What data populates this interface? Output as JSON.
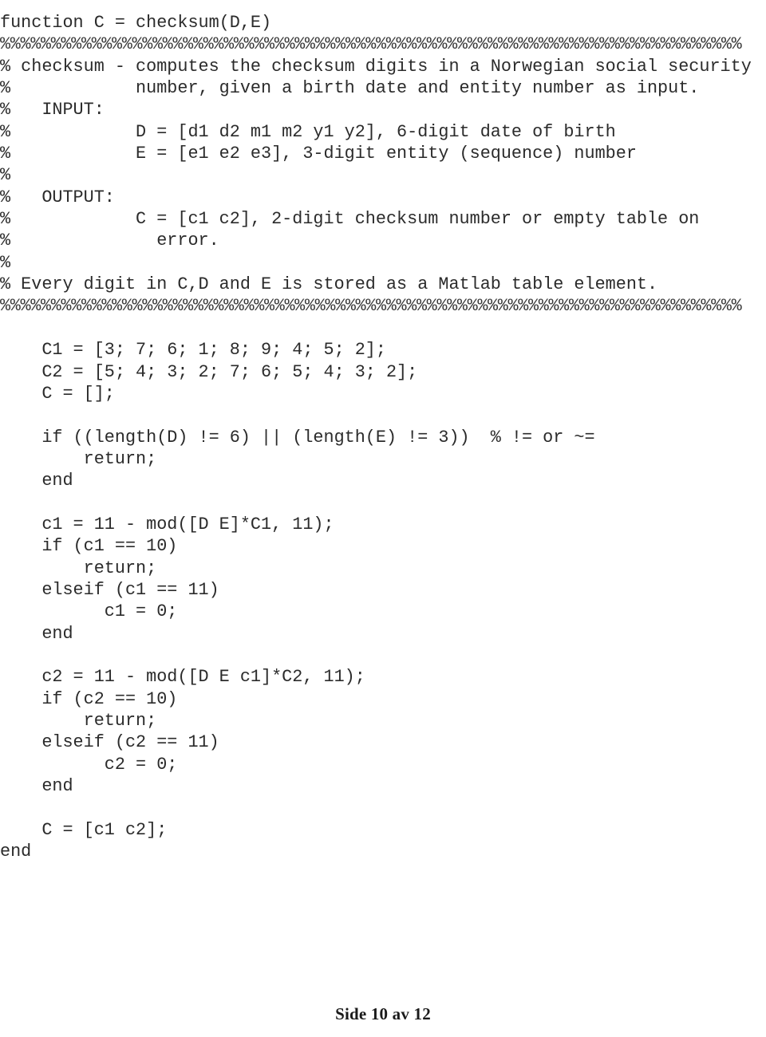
{
  "document": {
    "kind": "matlab-source-listing",
    "background_color": "#ffffff",
    "text_color": "#2b2b2b",
    "footer_color": "#1a1a1a"
  },
  "code": {
    "language": "MATLAB",
    "lines": [
      "function C = checksum(D,E)",
      "%%%%%%%%%%%%%%%%%%%%%%%%%%%%%%%%%%%%%%%%%%%%%%%%%%%%%%%%%%%%%%%%%%%%%%%%%",
      "% checksum - computes the checksum digits in a Norwegian social security",
      "%            number, given a birth date and entity number as input.",
      "%   INPUT:",
      "%            D = [d1 d2 m1 m2 y1 y2], 6-digit date of birth",
      "%            E = [e1 e2 e3], 3-digit entity (sequence) number",
      "%",
      "%   OUTPUT:",
      "%            C = [c1 c2], 2-digit checksum number or empty table on",
      "%              error.",
      "%",
      "% Every digit in C,D and E is stored as a Matlab table element.",
      "%%%%%%%%%%%%%%%%%%%%%%%%%%%%%%%%%%%%%%%%%%%%%%%%%%%%%%%%%%%%%%%%%%%%%%%%%",
      "",
      "    C1 = [3; 7; 6; 1; 8; 9; 4; 5; 2];",
      "    C2 = [5; 4; 3; 2; 7; 6; 5; 4; 3; 2];",
      "    C = [];",
      "",
      "    if ((length(D) != 6) || (length(E) != 3))  % != or ~=",
      "        return;",
      "    end",
      "",
      "    c1 = 11 - mod([D E]*C1, 11);",
      "    if (c1 == 10)",
      "        return;",
      "    elseif (c1 == 11)",
      "          c1 = 0;",
      "    end",
      "",
      "    c2 = 11 - mod([D E c1]*C2, 11);",
      "    if (c2 == 10)",
      "        return;",
      "    elseif (c2 == 11)",
      "          c2 = 0;",
      "    end",
      "",
      "    C = [c1 c2];",
      "end"
    ]
  },
  "footer": {
    "page_label": "Side 10 av 12"
  }
}
